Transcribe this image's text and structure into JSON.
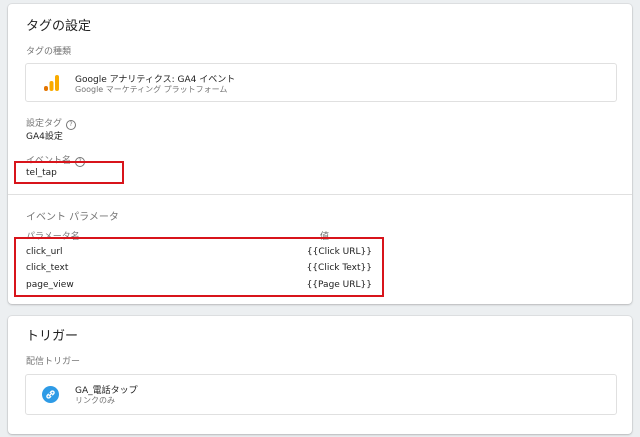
{
  "tag_config": {
    "title": "タグの設定",
    "tag_type_label": "タグの種類",
    "tag_type": {
      "name": "Google アナリティクス: GA4 イベント",
      "provider": "Google マーケティング プラットフォーム",
      "icon": "google-analytics-icon"
    },
    "config_tag_label": "設定タグ",
    "config_tag_value": "GA4設定",
    "event_name_label": "イベント名",
    "event_name_value": "tel_tap",
    "event_params_title": "イベント パラメータ",
    "param_name_header": "パラメータ名",
    "value_header": "値",
    "params": [
      {
        "name": "click_url",
        "value": "{{Click URL}}"
      },
      {
        "name": "click_text",
        "value": "{{Click Text}}"
      },
      {
        "name": "page_view",
        "value": "{{Page URL}}"
      }
    ]
  },
  "triggering": {
    "title": "トリガー",
    "firing_label": "配信トリガー",
    "trigger": {
      "name": "GA_電話タップ",
      "type": "リンクのみ",
      "icon": "link-icon"
    }
  },
  "colors": {
    "highlight": "#d8141b",
    "ga_orange": "#f9ab00",
    "ga_dark_orange": "#e37400",
    "link_blue": "#2e9be6"
  }
}
